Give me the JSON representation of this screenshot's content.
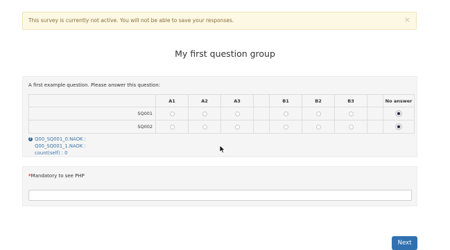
{
  "alert": {
    "message": "This survey is currently not active. You will not be able to save your responses.",
    "close_glyph": "×"
  },
  "group": {
    "title": "My first question group"
  },
  "question1": {
    "text": "A first example question. Please answer this question:",
    "columns": [
      "A1",
      "A2",
      "A3",
      "",
      "B1",
      "B2",
      "B3",
      "",
      "No answer"
    ],
    "rows": [
      {
        "label": "SQ001",
        "selected": "No answer"
      },
      {
        "label": "SQ002",
        "selected": "No answer"
      }
    ],
    "em_help": {
      "lines": [
        "Q00_SQ001_0.NAOK :",
        "Q00_SQ001_1.NAOK :",
        "count(self) : 0"
      ]
    }
  },
  "question2": {
    "mandatory_mark": "*",
    "text": "Mandatory to see PHP",
    "input_value": ""
  },
  "nav": {
    "next_label": "Next"
  },
  "colors": {
    "accent": "#3271b0",
    "alert_bg": "#fcf8e3",
    "alert_text": "#8a6d3b",
    "mandatory": "#c9302c"
  }
}
